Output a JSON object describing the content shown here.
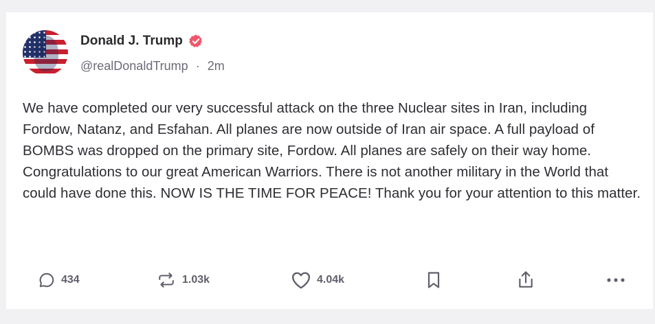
{
  "post": {
    "author": {
      "display_name": "Donald J. Trump",
      "handle": "@realDonaldTrump",
      "separator": "·",
      "time_ago": "2m",
      "verified_icon": "verified-badge-icon",
      "avatar": "american-flag-portrait"
    },
    "text": "We have completed our very successful attack on the three Nuclear sites in Iran, including Fordow, Natanz, and Esfahan. All planes are now outside of Iran air space. A full payload of BOMBS was dropped on the primary site, Fordow. All planes are safely on their way home. Congratulations to our great American Warriors. There is not another military in the World that could have done this. NOW IS THE TIME FOR PEACE! Thank you for your attention to this matter."
  },
  "actions": {
    "replies": {
      "icon": "reply-icon",
      "count": "434"
    },
    "retruths": {
      "icon": "repost-icon",
      "count": "1.03k"
    },
    "likes": {
      "icon": "heart-icon",
      "count": "4.04k"
    },
    "bookmark": {
      "icon": "bookmark-icon"
    },
    "share": {
      "icon": "share-icon"
    },
    "more": {
      "icon": "more-icon"
    }
  },
  "colors": {
    "verified": "#f0566b",
    "text": "#2d2d33",
    "muted": "#6b6b78",
    "background": "#f1f1f3",
    "card": "#ffffff"
  }
}
